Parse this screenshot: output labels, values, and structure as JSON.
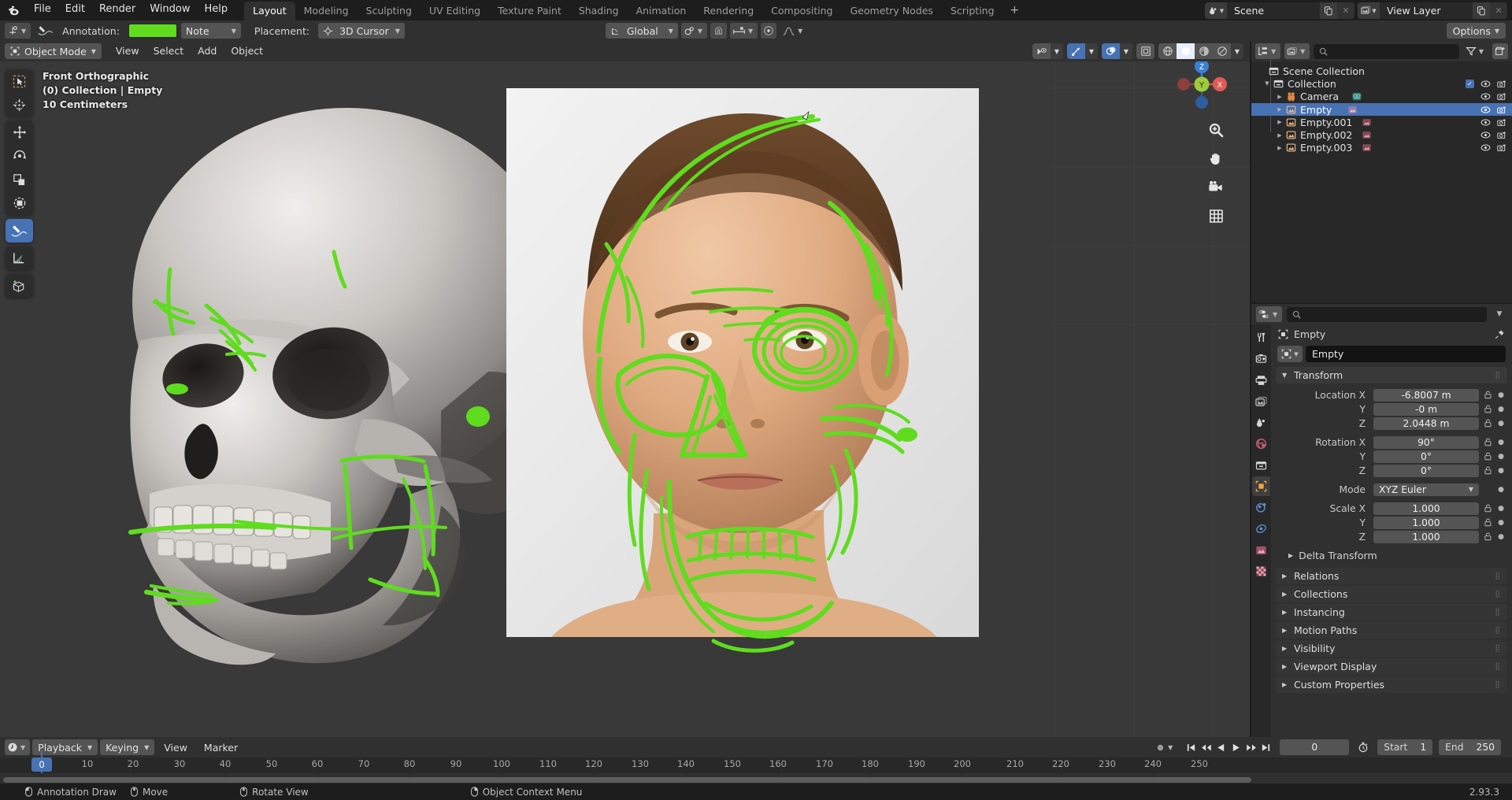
{
  "app": {
    "version": "2.93.3",
    "name": "Blender"
  },
  "topbar": {
    "logo_icon": "blender-logo-icon",
    "menus": [
      "File",
      "Edit",
      "Render",
      "Window",
      "Help"
    ],
    "workspace_tabs": [
      {
        "label": "Layout",
        "active": true
      },
      {
        "label": "Modeling",
        "active": false
      },
      {
        "label": "Sculpting",
        "active": false
      },
      {
        "label": "UV Editing",
        "active": false
      },
      {
        "label": "Texture Paint",
        "active": false
      },
      {
        "label": "Shading",
        "active": false
      },
      {
        "label": "Animation",
        "active": false
      },
      {
        "label": "Rendering",
        "active": false
      },
      {
        "label": "Compositing",
        "active": false
      },
      {
        "label": "Geometry Nodes",
        "active": false
      },
      {
        "label": "Scripting",
        "active": false
      }
    ],
    "add_workspace_label": "+",
    "scene": {
      "icon": "scene-icon",
      "name": "Scene",
      "new_label": "new-copy-icon",
      "unlink_label": "x"
    },
    "view_layer": {
      "icon": "view-layer-icon",
      "name": "View Layer",
      "new_label": "new-copy-icon",
      "unlink_label": "x"
    }
  },
  "tool_settings": {
    "active_tool_icon": "annotate-tool-icon",
    "brush_icon": "annotate-brush-icon",
    "annotation_label": "Annotation:",
    "annotation_color": "#5fdc1e",
    "layer_name": "Note",
    "placement_label": "Placement:",
    "placement_value": "3D Cursor",
    "placement_icon": "3d-cursor-icon",
    "transform_orientation": "Global",
    "transform_orientation_icon": "orientation-icon",
    "pivot_icon": "pivot-point-icon",
    "snap_magnet_icon": "snap-magnet-icon",
    "snap_target_icon": "snap-increment-icon",
    "proportional_icon": "proportional-edit-icon",
    "falloff_icon": "proportional-falloff-icon",
    "options_label": "Options"
  },
  "viewport": {
    "mode": "Object Mode",
    "mode_icon": "object-mode-icon",
    "menus": [
      "View",
      "Select",
      "Add",
      "Object"
    ],
    "overlay_text": {
      "view_name": "Front Orthographic",
      "collection_object": "(0) Collection | Empty",
      "grid_scale": "10 Centimeters"
    },
    "header_right": {
      "visibility_icon": "object-type-visibility-icon",
      "gizmo_icon": "gizmo-icon",
      "gizmo_active": true,
      "overlays_icon": "overlays-icon",
      "overlays_active": true,
      "xray_icon": "xray-toggle-icon",
      "shading_wireframe_icon": "shading-wireframe-icon",
      "shading_solid_icon": "shading-solid-icon",
      "shading_material_icon": "shading-material-preview-icon",
      "shading_rendered_icon": "shading-rendered-icon",
      "shading_active": "solid"
    },
    "toolbar": [
      {
        "name": "tweak-select-box-tool",
        "icon": "select-box-icon",
        "active": false
      },
      {
        "name": "cursor-tool",
        "icon": "3d-cursor-tool-icon",
        "active": false
      },
      {
        "name": "move-tool",
        "icon": "move-tool-icon",
        "active": false
      },
      {
        "name": "rotate-tool",
        "icon": "rotate-tool-icon",
        "active": false
      },
      {
        "name": "scale-tool",
        "icon": "scale-tool-icon",
        "active": false
      },
      {
        "name": "transform-tool",
        "icon": "transform-tool-icon",
        "active": false
      },
      {
        "name": "annotate-tool",
        "icon": "annotate-pencil-icon",
        "active": true
      },
      {
        "name": "measure-tool",
        "icon": "measure-ruler-icon",
        "active": false
      },
      {
        "name": "add-cube-tool",
        "icon": "add-cube-icon",
        "active": false
      }
    ],
    "gizmo": {
      "axis_z": "Z",
      "axis_y": "Y",
      "axis_x": "X"
    },
    "nav_buttons": [
      {
        "name": "zoom-view-button",
        "icon": "magnifier-plus-icon"
      },
      {
        "name": "pan-view-button",
        "icon": "hand-icon"
      },
      {
        "name": "camera-view-button",
        "icon": "camera-icon"
      },
      {
        "name": "toggle-perspective-button",
        "icon": "grid-perspective-icon"
      }
    ]
  },
  "outliner": {
    "display_mode_icon": "outliner-display-mode-icon",
    "filter_id_icon": "outliner-id-type-icon",
    "search_placeholder": "",
    "filter_icon": "filter-funnel-icon",
    "new_collection_icon": "new-collection-icon",
    "items": [
      {
        "name": "Scene Collection",
        "icon": "scene-collection-icon",
        "indent": 0,
        "disclosure": "",
        "selected": false,
        "checkbox": false,
        "eye": false,
        "camera": false
      },
      {
        "name": "Collection",
        "icon": "collection-icon",
        "indent": 1,
        "disclosure": "down",
        "selected": false,
        "checkbox": true,
        "eye": true,
        "camera": true
      },
      {
        "name": "Camera",
        "icon": "camera-object-icon",
        "indent": 2,
        "disclosure": "right",
        "selected": false,
        "checkbox": false,
        "eye": true,
        "camera": true,
        "data_icon": "camera-data-icon"
      },
      {
        "name": "Empty",
        "icon": "empty-image-icon",
        "indent": 2,
        "disclosure": "right",
        "selected": true,
        "checkbox": false,
        "eye": true,
        "camera": true,
        "data_icon": "image-data-icon"
      },
      {
        "name": "Empty.001",
        "icon": "empty-image-icon",
        "indent": 2,
        "disclosure": "right",
        "selected": false,
        "checkbox": false,
        "eye": true,
        "camera": true,
        "data_icon": "image-data-icon"
      },
      {
        "name": "Empty.002",
        "icon": "empty-image-icon",
        "indent": 2,
        "disclosure": "right",
        "selected": false,
        "checkbox": false,
        "eye": true,
        "camera": true,
        "data_icon": "image-data-icon"
      },
      {
        "name": "Empty.003",
        "icon": "empty-image-icon",
        "indent": 2,
        "disclosure": "right",
        "selected": false,
        "checkbox": false,
        "eye": true,
        "camera": true,
        "data_icon": "image-data-icon"
      }
    ]
  },
  "properties": {
    "editor_icon": "properties-editor-icon",
    "search_placeholder": "",
    "breadcrumb": "Empty",
    "breadcrumb_icon": "object-properties-icon",
    "pin_icon": "pin-icon",
    "id_name": "Empty",
    "id_icon": "object-properties-icon",
    "tabs": [
      {
        "name": "tool-tab",
        "icon": "tool-screwdriver-wrench-icon",
        "active": false
      },
      {
        "name": "render-tab",
        "icon": "render-camera-back-icon",
        "active": false
      },
      {
        "name": "output-tab",
        "icon": "output-printer-icon",
        "active": false
      },
      {
        "name": "view-layer-tab",
        "icon": "view-layer-images-icon",
        "active": false
      },
      {
        "name": "scene-tab",
        "icon": "scene-cone-sphere-icon",
        "active": false
      },
      {
        "name": "world-tab",
        "icon": "world-globe-icon",
        "active": false
      },
      {
        "name": "collection-tab",
        "icon": "collection-box-icon",
        "active": false
      },
      {
        "name": "object-tab",
        "icon": "object-orange-square-icon",
        "active": true
      },
      {
        "name": "modifiers-tab",
        "icon": "physics-blue-icon",
        "active": false
      },
      {
        "name": "constraints-tab",
        "icon": "constraints-icon",
        "active": false
      },
      {
        "name": "object-data-tab",
        "icon": "object-data-image-icon",
        "active": false
      },
      {
        "name": "texture-tab",
        "icon": "texture-checker-icon",
        "active": false
      }
    ],
    "transform": {
      "title": "Transform",
      "rows": [
        {
          "label": "Location X",
          "value": "-6.8007 m"
        },
        {
          "label": "Y",
          "value": "-0 m"
        },
        {
          "label": "Z",
          "value": "2.0448 m"
        },
        {
          "label": "Rotation X",
          "value": "90°"
        },
        {
          "label": "Y",
          "value": "0°"
        },
        {
          "label": "Z",
          "value": "0°"
        }
      ],
      "mode_label": "Mode",
      "mode_value": "XYZ Euler",
      "scale_rows": [
        {
          "label": "Scale X",
          "value": "1.000"
        },
        {
          "label": "Y",
          "value": "1.000"
        },
        {
          "label": "Z",
          "value": "1.000"
        }
      ],
      "delta_transform_label": "Delta Transform"
    },
    "panels": [
      "Relations",
      "Collections",
      "Instancing",
      "Motion Paths",
      "Visibility",
      "Viewport Display",
      "Custom Properties"
    ]
  },
  "timeline": {
    "editor_icon": "timeline-editor-icon",
    "menus_dd": [
      "Playback",
      "Keying"
    ],
    "menus": [
      "View",
      "Marker"
    ],
    "record_icon": "auto-keying-record-icon",
    "playback_buttons": [
      {
        "name": "jump-to-start-button",
        "icon": "jump-start-icon"
      },
      {
        "name": "jump-to-prev-keyframe-button",
        "icon": "prev-keyframe-icon"
      },
      {
        "name": "play-reverse-button",
        "icon": "play-reverse-icon"
      },
      {
        "name": "play-button",
        "icon": "play-icon"
      },
      {
        "name": "jump-to-next-keyframe-button",
        "icon": "next-keyframe-icon"
      },
      {
        "name": "jump-to-end-button",
        "icon": "jump-end-icon"
      }
    ],
    "current_frame": "0",
    "use_preview_range_icon": "stopwatch-icon",
    "start_label": "Start",
    "start_value": "1",
    "end_label": "End",
    "end_value": "250",
    "ruler_ticks": [
      0,
      10,
      20,
      30,
      40,
      50,
      60,
      70,
      80,
      90,
      100,
      110,
      120,
      130,
      140,
      150,
      160,
      170,
      180,
      190,
      200,
      210,
      220,
      230,
      240,
      250
    ],
    "playhead_frame": "0"
  },
  "statusbar": {
    "keymap": [
      {
        "icon": "mouse-left-icon",
        "label": "Annotation Draw"
      },
      {
        "icon": "mouse-move-icon",
        "label": "Move"
      },
      {
        "icon": "mouse-middle-icon",
        "label": "Rotate View"
      },
      {
        "icon": "mouse-right-icon",
        "label": "Object Context Menu"
      }
    ],
    "version": "2.93.3"
  },
  "colors": {
    "accent_blue": "#4772b3",
    "annotation_green": "#5fdc1e",
    "header_gray": "#303030",
    "editor_gray": "#282828",
    "viewport_gray": "#393939",
    "axis_x": "#d9534f",
    "axis_y": "#8fbf2f",
    "axis_z": "#3a7fd5"
  }
}
